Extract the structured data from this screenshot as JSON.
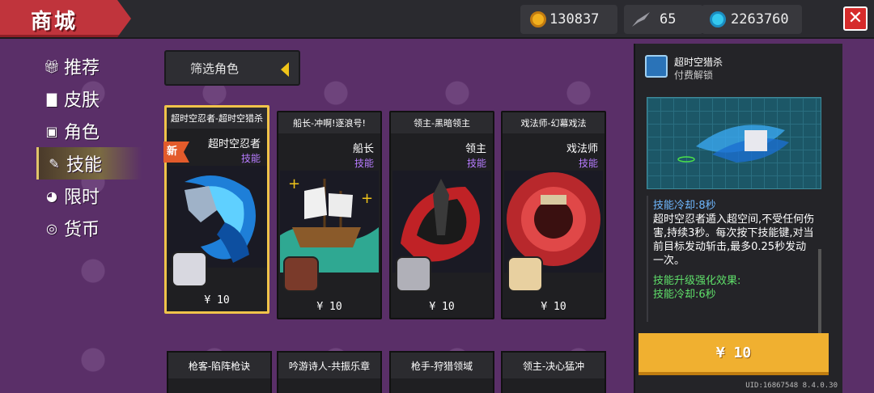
{
  "header": {
    "title": "商城",
    "gold": "130837",
    "feathers": "65",
    "gems": "2263760",
    "close_label": "✕"
  },
  "sidebar": {
    "items": [
      {
        "label": "推荐",
        "icon": "gift-icon"
      },
      {
        "label": "皮肤",
        "icon": "shirt-icon"
      },
      {
        "label": "角色",
        "icon": "helmet-icon"
      },
      {
        "label": "技能",
        "icon": "skill-icon"
      },
      {
        "label": "限时",
        "icon": "clock-icon"
      },
      {
        "label": "货币",
        "icon": "coin-icon"
      }
    ],
    "active_index": 3
  },
  "filter": {
    "label": "筛选角色"
  },
  "cards": [
    {
      "title": "超时空忍者-超时空猎杀",
      "name": "超时空忍者",
      "type": "技能",
      "price": "¥ 10",
      "badge": "新"
    },
    {
      "title": "船长-冲啊!逐浪号!",
      "name": "船长",
      "type": "技能",
      "price": "¥ 10"
    },
    {
      "title": "领主-黑暗领主",
      "name": "领主",
      "type": "技能",
      "price": "¥ 10"
    },
    {
      "title": "戏法师-幻幕戏法",
      "name": "戏法师",
      "type": "技能",
      "price": "¥ 10"
    }
  ],
  "cards_row2": [
    {
      "title": "枪客-陷阵枪诀"
    },
    {
      "title": "吟游诗人-共振乐章"
    },
    {
      "title": "枪手-狩猎领域"
    },
    {
      "title": "领主-决心猛冲"
    }
  ],
  "detail": {
    "name": "超时空猎杀",
    "unlock": "付费解锁",
    "cooldown": "技能冷却:8秒",
    "description": "超时空忍者遁入超空间,不受任何伤害,持续3秒。每次按下技能键,对当前目标发动斩击,最多0.25秒发动一次。",
    "upgrade_title": "技能升级强化效果:",
    "upgrade_cooldown": "技能冷却:6秒",
    "buy_label": "¥ 10",
    "uid": "UID:16867548 8.4.0.30"
  },
  "colors": {
    "accent": "#f0b030",
    "skill_type": "#b77cff",
    "background": "#5a2f68",
    "title_red": "#c0343c"
  }
}
